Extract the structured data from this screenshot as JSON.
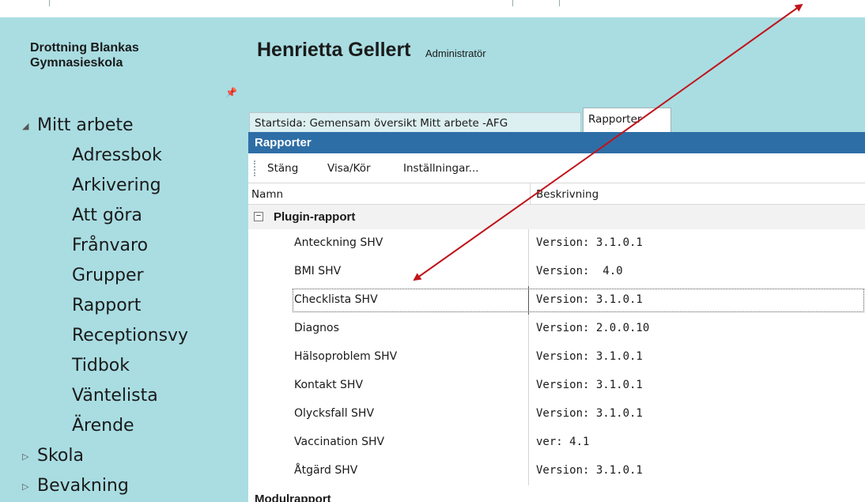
{
  "header": {
    "school_name": "Drottning Blankas Gymnasieskola",
    "user_name": "Henrietta Gellert",
    "user_role": "Administratör"
  },
  "sidebar": {
    "pin_icon": "pin-icon",
    "items": [
      {
        "label": "Mitt arbete",
        "expander": "expanded",
        "level": 0
      },
      {
        "label": "Adressbok",
        "level": 1
      },
      {
        "label": "Arkivering",
        "level": 1
      },
      {
        "label": "Att göra",
        "level": 1
      },
      {
        "label": "Frånvaro",
        "level": 1
      },
      {
        "label": "Grupper",
        "level": 1
      },
      {
        "label": "Rapport",
        "level": 1
      },
      {
        "label": "Receptionsvy",
        "level": 1
      },
      {
        "label": "Tidbok",
        "level": 1
      },
      {
        "label": "Väntelista",
        "level": 1
      },
      {
        "label": "Ärende",
        "level": 1
      },
      {
        "label": "Skola",
        "expander": "collapsed",
        "level": 0
      },
      {
        "label": "Bevakning",
        "expander": "collapsed",
        "level": 0
      }
    ]
  },
  "tabs": [
    {
      "label": "Startsida: Gemensam översikt Mitt arbete -AFG",
      "active": false
    },
    {
      "label": "Rapporter",
      "active": true
    }
  ],
  "panel": {
    "title": "Rapporter",
    "toolbar": [
      "Stäng",
      "Visa/Kör",
      "Inställningar..."
    ],
    "columns": [
      "Namn",
      "Beskrivning"
    ],
    "groups": [
      {
        "label": "Plugin-rapport",
        "expand_symbol": "−",
        "rows": [
          {
            "name": "Anteckning SHV",
            "desc": "Version: 3.1.0.1"
          },
          {
            "name": "BMI SHV",
            "desc": "Version:  4.0"
          },
          {
            "name": "Checklista SHV",
            "desc": "Version: 3.1.0.1",
            "selected": true
          },
          {
            "name": "Diagnos",
            "desc": "Version: 2.0.0.10"
          },
          {
            "name": "Hälsoproblem SHV",
            "desc": "Version: 3.1.0.1"
          },
          {
            "name": "Kontakt SHV",
            "desc": "Version: 3.1.0.1"
          },
          {
            "name": "Olycksfall SHV",
            "desc": "Version: 3.1.0.1"
          },
          {
            "name": "Vaccination SHV",
            "desc": "ver: 4.1"
          },
          {
            "name": "Åtgärd SHV",
            "desc": "Version: 3.1.0.1"
          }
        ]
      },
      {
        "label": "Modulrapport",
        "rows": []
      }
    ]
  },
  "colors": {
    "app_background": "#a9dde2",
    "title_bar": "#2e6ea6",
    "arrow": "#c0141b"
  }
}
